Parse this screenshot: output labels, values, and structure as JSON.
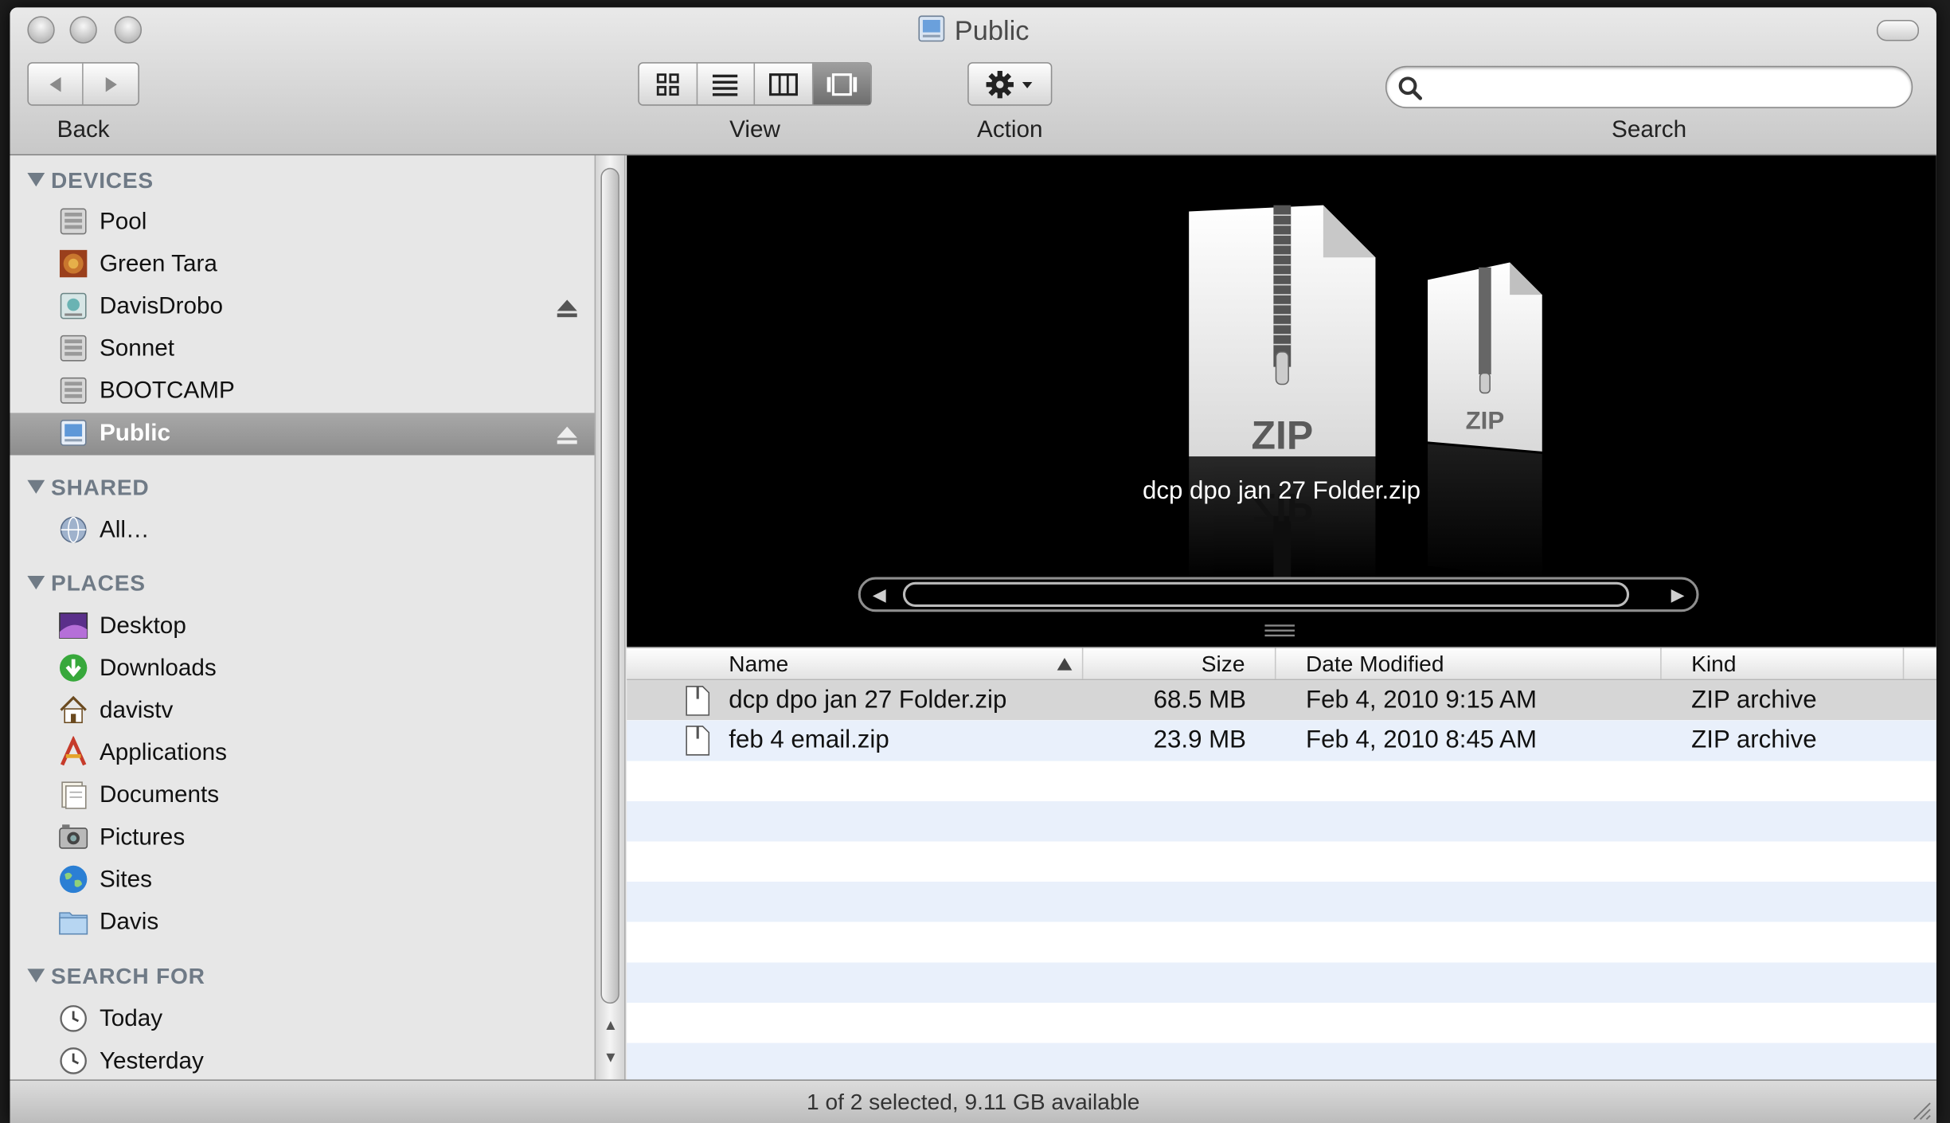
{
  "window": {
    "title": "Public"
  },
  "toolbar": {
    "back_label": "Back",
    "view_label": "View",
    "action_label": "Action",
    "search_label": "Search",
    "search_value": "",
    "view_modes": [
      "icon-view",
      "list-view",
      "column-view",
      "cover-flow-view"
    ],
    "active_view": "cover-flow-view"
  },
  "sidebar": {
    "devices": {
      "header": "DEVICES",
      "items": [
        {
          "label": "Pool",
          "icon": "hard-drive-icon"
        },
        {
          "label": "Green Tara",
          "icon": "custom-drive-icon"
        },
        {
          "label": "DavisDrobo",
          "icon": "external-drive-icon",
          "eject": true
        },
        {
          "label": "Sonnet",
          "icon": "hard-drive-icon"
        },
        {
          "label": "BOOTCAMP",
          "icon": "hard-drive-icon"
        },
        {
          "label": "Public",
          "icon": "network-volume-icon",
          "eject": true,
          "selected": true
        }
      ]
    },
    "shared": {
      "header": "SHARED",
      "items": [
        {
          "label": "All…",
          "icon": "network-globe-icon"
        }
      ]
    },
    "places": {
      "header": "PLACES",
      "items": [
        {
          "label": "Desktop",
          "icon": "desktop-icon"
        },
        {
          "label": "Downloads",
          "icon": "downloads-icon"
        },
        {
          "label": "davistv",
          "icon": "home-icon"
        },
        {
          "label": "Applications",
          "icon": "applications-icon"
        },
        {
          "label": "Documents",
          "icon": "documents-icon"
        },
        {
          "label": "Pictures",
          "icon": "pictures-icon"
        },
        {
          "label": "Sites",
          "icon": "sites-icon"
        },
        {
          "label": "Davis",
          "icon": "folder-icon"
        }
      ]
    },
    "search_for": {
      "header": "SEARCH FOR",
      "items": [
        {
          "label": "Today",
          "icon": "clock-icon"
        },
        {
          "label": "Yesterday",
          "icon": "clock-icon"
        }
      ]
    }
  },
  "coverflow": {
    "caption": "dcp dpo jan 27 Folder.zip",
    "cover_label": "ZIP",
    "cover_label_reflected": "ZIP"
  },
  "list": {
    "columns": [
      "Name",
      "Size",
      "Date Modified",
      "Kind"
    ],
    "sort_column": "Name",
    "rows": [
      {
        "name": "dcp dpo jan 27 Folder.zip",
        "size": "68.5 MB",
        "date": "Feb 4, 2010 9:15 AM",
        "kind": "ZIP archive",
        "selected": true
      },
      {
        "name": "feb 4 email.zip",
        "size": "23.9 MB",
        "date": "Feb 4, 2010 8:45 AM",
        "kind": "ZIP archive",
        "selected": false
      }
    ]
  },
  "status": {
    "text": "1 of 2 selected, 9.11 GB available"
  }
}
